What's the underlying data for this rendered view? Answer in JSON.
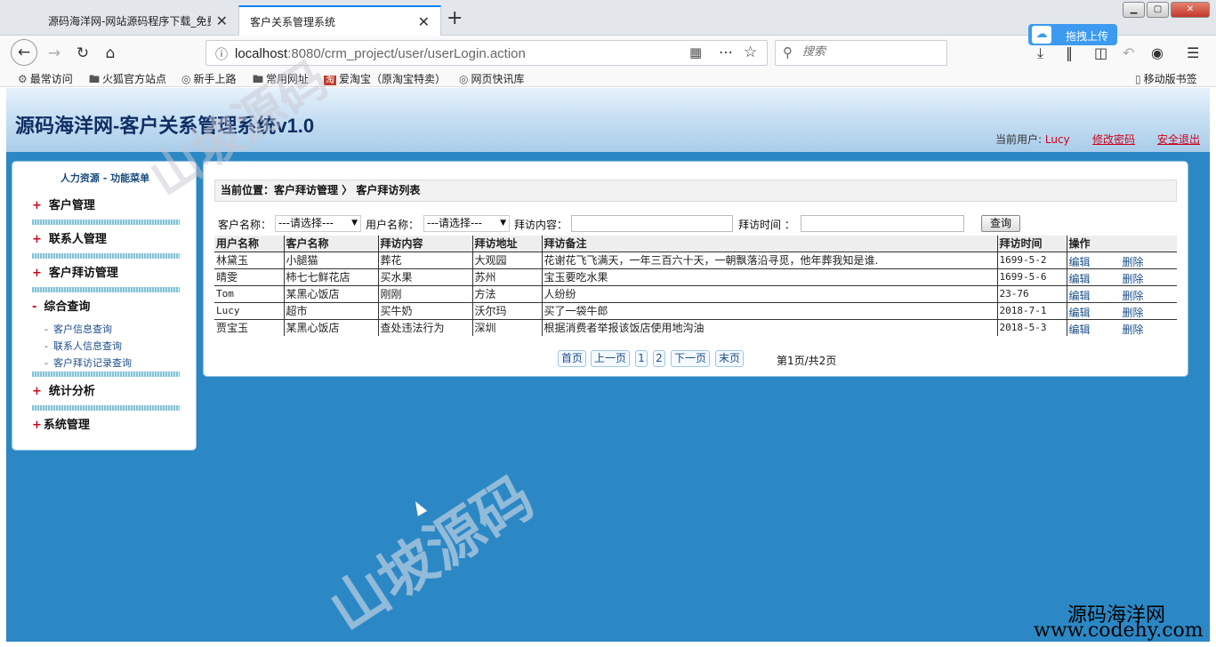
{
  "browser": {
    "tabs": [
      {
        "title": "源码海洋网-网站源码程序下载_免费",
        "close": "✕"
      },
      {
        "title": "客户关系管理系统",
        "close": "✕"
      }
    ],
    "new_tab": "+",
    "window_buttons": {
      "min": "▁",
      "max": "▢",
      "close": "✕"
    },
    "url": {
      "host": "localhost",
      "rest": ":8080/crm_project/user/userLogin.action"
    },
    "search_placeholder": "搜索",
    "cloud_upload_label": "拖拽上传",
    "bookmarks": [
      {
        "icon": "gear-icon",
        "label": "最常访问"
      },
      {
        "icon": "folder-icon",
        "label": "火狐官方站点"
      },
      {
        "icon": "globe-icon",
        "label": "新手上路"
      },
      {
        "icon": "folder-icon",
        "label": "常用网址"
      },
      {
        "icon": "taobao-icon",
        "label": "爱淘宝（原淘宝特卖）"
      },
      {
        "icon": "globe-icon",
        "label": "网页快讯库"
      }
    ],
    "mobile_bookmarks": "移动版书签"
  },
  "app": {
    "title": "源码海洋网-客户关系管理系统v1.0",
    "current_user_label": "当前用户: ",
    "current_user": "Lucy",
    "change_password": "修改密码",
    "logout": "安全退出"
  },
  "sidebar": {
    "header": "人力资源 - 功能菜单",
    "sections": [
      {
        "sign": "+",
        "label": "客户管理"
      },
      {
        "sign": "+",
        "label": "联系人管理"
      },
      {
        "sign": "+",
        "label": "客户拜访管理"
      },
      {
        "sign": "-",
        "label": "综合查询"
      },
      {
        "sign": "+",
        "label": "统计分析"
      },
      {
        "sign": "+",
        "label": "系统管理"
      }
    ],
    "sub_items": [
      {
        "sign": "-",
        "label": "客户信息查询"
      },
      {
        "sign": "-",
        "label": "联系人信息查询"
      },
      {
        "sign": "-",
        "label": "客户拜访记录查询"
      }
    ]
  },
  "content": {
    "breadcrumb": "当前位置：客户拜访管理 〉 客户拜访列表",
    "filters": {
      "customer_label": "客户名称：",
      "customer_value": "---请选择---",
      "user_label": "用户名称：",
      "user_value": "---请选择---",
      "content_label": "拜访内容：",
      "time_label": "拜访时间 ：",
      "query_button": "查询"
    },
    "table": {
      "headers": [
        "用户名称",
        "客户名称",
        "拜访内容",
        "拜访地址",
        "拜访备注",
        "拜访时间",
        "操作"
      ],
      "rows": [
        [
          "林黛玉",
          "小腿猫",
          "葬花",
          "大观园",
          "花谢花飞飞满天，一年三百六十天，一朝飘落沿寻觅，他年葬我知是谁.",
          "1699-5-2"
        ],
        [
          "晴雯",
          "柿七七鲜花店",
          "买水果",
          "苏州",
          "宝玉要吃水果",
          "1699-5-6"
        ],
        [
          "Tom",
          "某黑心饭店",
          "刚刚",
          "方法",
          "人纷纷",
          "23-76"
        ],
        [
          "Lucy",
          "超市",
          "买牛奶",
          "沃尔玛",
          "买了一袋牛郎",
          "2018-7-1"
        ],
        [
          "贾宝玉",
          "某黑心饭店",
          "查处违法行为",
          "深圳",
          "根据消费者举报该饭店使用地沟油",
          "2018-5-3"
        ]
      ],
      "edit_label": "编辑",
      "delete_label": "删除"
    },
    "pager": {
      "first": "首页",
      "prev": "上一页",
      "pages": [
        "1",
        "2"
      ],
      "next": "下一页",
      "last": "末页",
      "info": "第1页/共2页"
    }
  },
  "watermarks": [
    "山坡源码",
    "山坡源码"
  ],
  "site_mark": "源码海洋网",
  "site_url": "www.codehy.com",
  "colors": {
    "page_bg": "#2b88c5",
    "accent_red": "#d0021b",
    "link_blue": "#1c4f8a"
  }
}
